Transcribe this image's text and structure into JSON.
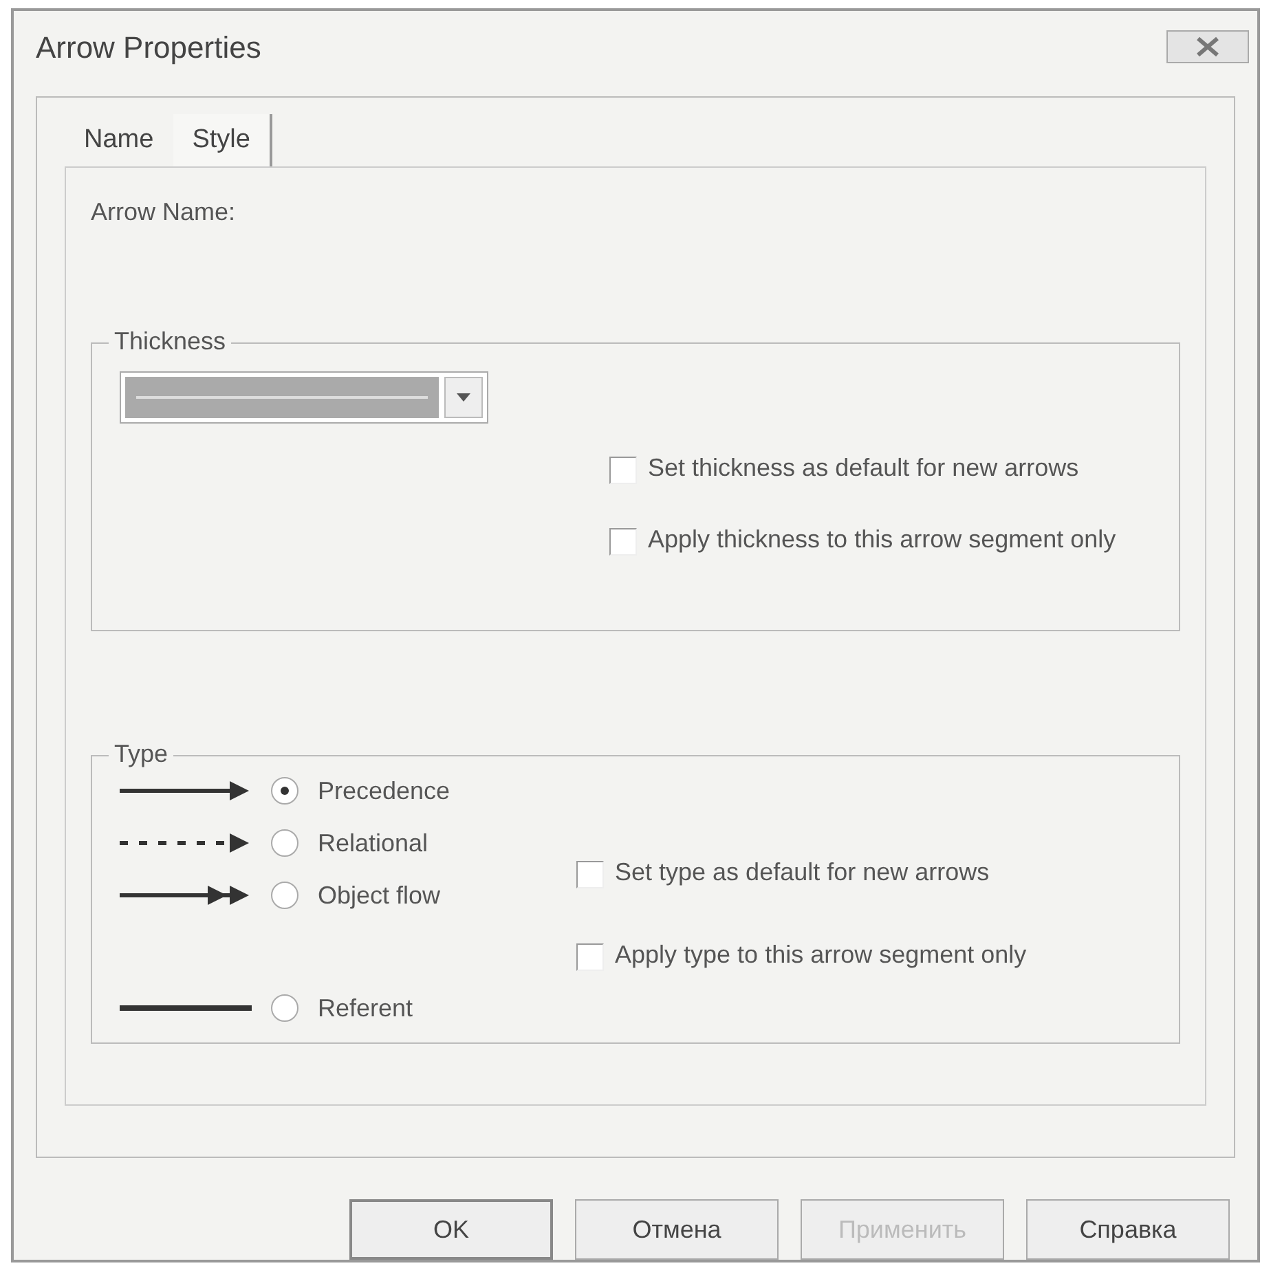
{
  "window": {
    "title": "Arrow Properties"
  },
  "tabs": [
    {
      "label": "Name",
      "selected": false
    },
    {
      "label": "Style",
      "selected": true
    }
  ],
  "arrow_name_label": "Arrow Name:",
  "thickness": {
    "title": "Thickness",
    "dropdown": {
      "disabled": true
    },
    "options": [
      {
        "label": "Set thickness as default for new arrows",
        "checked": false
      },
      {
        "label": "Apply thickness to this arrow segment only",
        "checked": false
      }
    ]
  },
  "type": {
    "title": "Type",
    "types": [
      {
        "label": "Precedence",
        "kind": "solid",
        "selected": true
      },
      {
        "label": "Relational",
        "kind": "dashed",
        "selected": false
      },
      {
        "label": "Object flow",
        "kind": "double",
        "selected": false
      },
      {
        "label": "Referent",
        "kind": "plain",
        "selected": false
      }
    ],
    "options": [
      {
        "label": "Set type as default for new arrows",
        "checked": false
      },
      {
        "label": "Apply type to this arrow segment only",
        "checked": false
      }
    ]
  },
  "buttons": [
    {
      "label": "OK",
      "disabled": false,
      "default": true
    },
    {
      "label": "Отмена",
      "disabled": false,
      "default": false
    },
    {
      "label": "Применить",
      "disabled": true,
      "default": false
    },
    {
      "label": "Справка",
      "disabled": false,
      "default": false
    }
  ]
}
